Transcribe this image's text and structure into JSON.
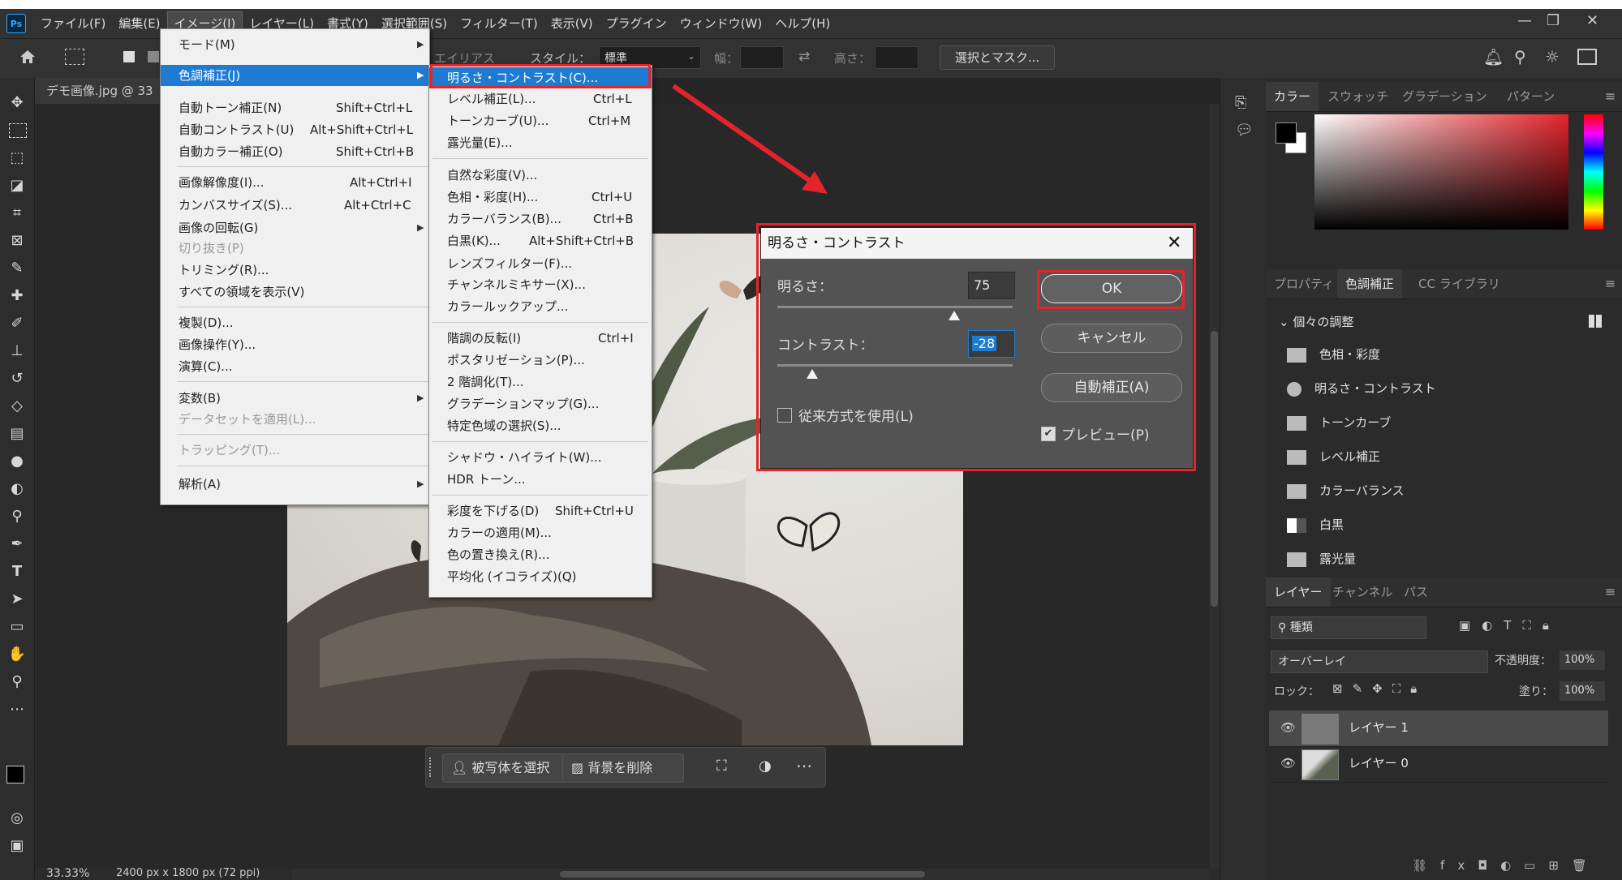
{
  "menubar": {
    "logo": "Ps",
    "items": [
      "ファイル(F)",
      "編集(E)",
      "イメージ(I)",
      "レイヤー(L)",
      "書式(Y)",
      "選択範囲(S)",
      "フィルター(T)",
      "表示(V)",
      "プラグイン",
      "ウィンドウ(W)",
      "ヘルプ(H)"
    ],
    "window_controls": [
      "—",
      "❐",
      "✕"
    ]
  },
  "optbar": {
    "antialias": "エイリアス",
    "style_label": "スタイル：",
    "style_value": "標準",
    "width_label": "幅：",
    "height_label": "高さ：",
    "select_mask": "選択とマスク..."
  },
  "document": {
    "tab": "デモ画像.jpg @ 33",
    "zoom": "33.33%",
    "size_info": "2400 px x 1800 px (72 ppi)"
  },
  "image_menu": {
    "items": [
      {
        "label": "モード(M)",
        "shortcut": "",
        "submenu": true
      },
      {
        "label": "色調補正(J)",
        "shortcut": "",
        "submenu": true
      },
      {
        "label": "自動トーン補正(N)",
        "shortcut": "Shift+Ctrl+L"
      },
      {
        "label": "自動コントラスト(U)",
        "shortcut": "Alt+Shift+Ctrl+L"
      },
      {
        "label": "自動カラー補正(O)",
        "shortcut": "Shift+Ctrl+B"
      },
      {
        "label": "画像解像度(I)...",
        "shortcut": "Alt+Ctrl+I"
      },
      {
        "label": "カンバスサイズ(S)...",
        "shortcut": "Alt+Ctrl+C"
      },
      {
        "label": "画像の回転(G)",
        "shortcut": "",
        "submenu": true
      },
      {
        "label": "切り抜き(P)",
        "shortcut": "",
        "disabled": true
      },
      {
        "label": "トリミング(R)...",
        "shortcut": ""
      },
      {
        "label": "すべての領域を表示(V)",
        "shortcut": ""
      },
      {
        "label": "複製(D)...",
        "shortcut": ""
      },
      {
        "label": "画像操作(Y)...",
        "shortcut": ""
      },
      {
        "label": "演算(C)...",
        "shortcut": ""
      },
      {
        "label": "変数(B)",
        "shortcut": "",
        "submenu": true
      },
      {
        "label": "データセットを適用(L)...",
        "shortcut": "",
        "disabled": true
      },
      {
        "label": "トラッピング(T)...",
        "shortcut": "",
        "disabled": true
      },
      {
        "label": "解析(A)",
        "shortcut": "",
        "submenu": true
      }
    ]
  },
  "adjust_menu": {
    "items": [
      {
        "label": "明るさ・コントラスト(C)...",
        "shortcut": ""
      },
      {
        "label": "レベル補正(L)...",
        "shortcut": "Ctrl+L"
      },
      {
        "label": "トーンカーブ(U)...",
        "shortcut": "Ctrl+M"
      },
      {
        "label": "露光量(E)...",
        "shortcut": ""
      },
      {
        "label": "自然な彩度(V)...",
        "shortcut": ""
      },
      {
        "label": "色相・彩度(H)...",
        "shortcut": "Ctrl+U"
      },
      {
        "label": "カラーバランス(B)...",
        "shortcut": "Ctrl+B"
      },
      {
        "label": "白黒(K)...",
        "shortcut": "Alt+Shift+Ctrl+B"
      },
      {
        "label": "レンズフィルター(F)...",
        "shortcut": ""
      },
      {
        "label": "チャンネルミキサー(X)...",
        "shortcut": ""
      },
      {
        "label": "カラールックアップ...",
        "shortcut": ""
      },
      {
        "label": "階調の反転(I)",
        "shortcut": "Ctrl+I"
      },
      {
        "label": "ポスタリゼーション(P)...",
        "shortcut": ""
      },
      {
        "label": "2 階調化(T)...",
        "shortcut": ""
      },
      {
        "label": "グラデーションマップ(G)...",
        "shortcut": ""
      },
      {
        "label": "特定色域の選択(S)...",
        "shortcut": ""
      },
      {
        "label": "シャドウ・ハイライト(W)...",
        "shortcut": ""
      },
      {
        "label": "HDR トーン...",
        "shortcut": ""
      },
      {
        "label": "彩度を下げる(D)",
        "shortcut": "Shift+Ctrl+U"
      },
      {
        "label": "カラーの適用(M)...",
        "shortcut": ""
      },
      {
        "label": "色の置き換え(R)...",
        "shortcut": ""
      },
      {
        "label": "平均化 (イコライズ)(Q)",
        "shortcut": ""
      }
    ]
  },
  "dialog": {
    "title": "明るさ・コントラスト",
    "brightness_label": "明るさ：",
    "brightness_value": "75",
    "brightness_range": [
      -150,
      150
    ],
    "contrast_label": "コントラスト：",
    "contrast_value": "-28",
    "contrast_range": [
      -50,
      100
    ],
    "legacy_label": "従来方式を使用(L)",
    "legacy_checked": false,
    "ok": "OK",
    "cancel": "キャンセル",
    "auto": "自動補正(A)",
    "preview_label": "プレビュー(P)",
    "preview_checked": true
  },
  "ctxbar": {
    "select_subject": "被写体を選択",
    "remove_bg": "背景を削除"
  },
  "color_panel": {
    "tabs": [
      "カラー",
      "スウォッチ",
      "グラデーション",
      "パターン"
    ]
  },
  "adjust_panel": {
    "tabs": [
      "プロパティ",
      "色調補正",
      "CC ライブラリ"
    ],
    "section": "個々の調整",
    "items": [
      "色相・彩度",
      "明るさ・コントラスト",
      "トーンカーブ",
      "レベル補正",
      "カラーバランス",
      "白黒",
      "露光量"
    ]
  },
  "layers_panel": {
    "tabs": [
      "レイヤー",
      "チャンネル",
      "パス"
    ],
    "filter": "種類",
    "blend_mode": "オーバーレイ",
    "opacity_label": "不透明度：",
    "opacity": "100%",
    "lock_label": "ロック：",
    "fill_label": "塗り：",
    "fill": "100%",
    "layers": [
      "レイヤー 1",
      "レイヤー 0"
    ]
  },
  "colors": {
    "highlight": "#1f7bd1",
    "annotation_red": "#e3242b",
    "ps_blue": "#31a8ff"
  }
}
